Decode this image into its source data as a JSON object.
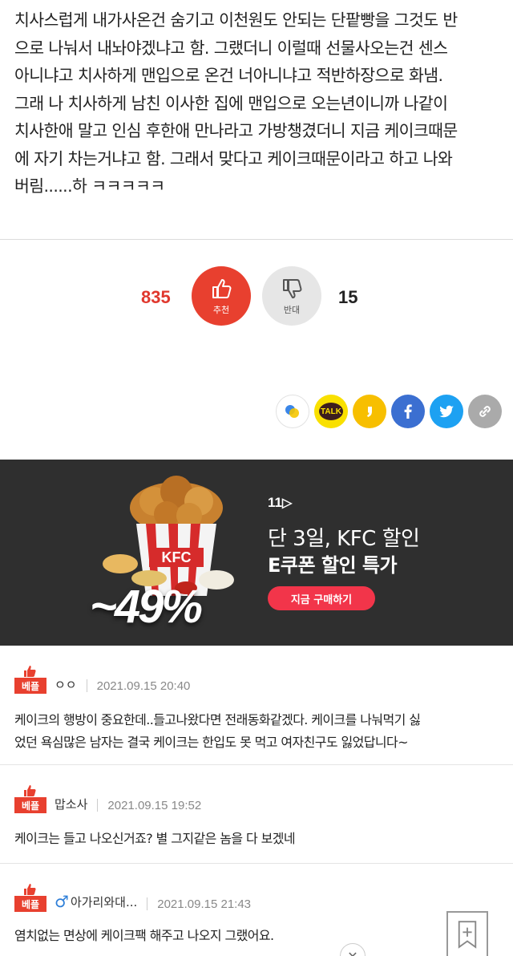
{
  "article": {
    "lines": [
      "치사스럽게 내가사온건 숨기고 이천원도 안되는 단팥빵을 그것도 반",
      "으로 나눠서 내놔야겠냐고 함. 그랬더니 이럴때 선물사오는건 센스",
      "아니냐고 치사하게 맨입으로 온건 너아니냐고 적반하장으로 화냄.",
      "그래 나 치사하게 남친 이사한 집에 맨입으로 오는년이니까 나같이",
      "치사한애 말고 인심 후한애 만나라고 가방챙겼더니 지금 케이크때문",
      "에 자기 차는거냐고 함. 그래서 맞다고 케이크때문이라고 하고 나와",
      "버림......하 ㅋㅋㅋㅋㅋ"
    ]
  },
  "votes": {
    "up_count": "835",
    "up_label": "추천",
    "down_count": "15",
    "down_label": "반대"
  },
  "share": {
    "kakaotalk_label": "TALK"
  },
  "ad": {
    "logo": "11",
    "line1": "단 3일, KFC 할인",
    "line2": "E쿠폰 할인 특가",
    "cta": "지금 구매하기",
    "discount": "~49%",
    "brand": "KFC"
  },
  "comments": [
    {
      "badge": "베플",
      "author": "ㅇㅇ",
      "date": "2021.09.15 20:40",
      "lines": [
        "케이크의 행방이 중요한데..들고나왔다면 전래동화같겠다. 케이크를 나눠먹기 싫",
        "었던 욕심많은 남자는 결국 케이크는 한입도 못 먹고 여자친구도 잃었답니다~"
      ]
    },
    {
      "badge": "베플",
      "author": "맙소사",
      "date": "2021.09.15 19:52",
      "lines": [
        "케이크는 들고 나오신거죠? 별 그지같은 놈을 다 보겠네"
      ]
    },
    {
      "badge": "베플",
      "author": "아가리와대...",
      "date": "2021.09.15 21:43",
      "lines": [
        "염치없는 면상에 케이크팩 해주고 나오지 그랬어요."
      ]
    }
  ],
  "colors": {
    "accent_red": "#e8402f",
    "ad_background": "#2f2f2f",
    "ad_cta": "#f2354a",
    "kakao_yellow": "#f9e000",
    "facebook_blue": "#3b6fd1",
    "twitter_blue": "#1da1f2"
  }
}
